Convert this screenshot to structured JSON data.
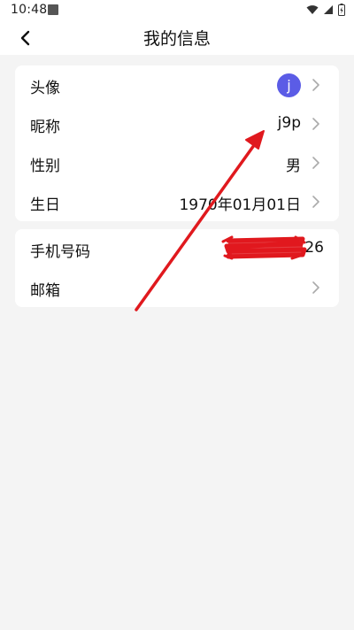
{
  "status_bar": {
    "time": "10:48"
  },
  "header": {
    "title": "我的信息",
    "back_icon": "chevron-left-icon"
  },
  "profile_card": {
    "avatar": {
      "label": "头像",
      "initial": "j",
      "color": "#5b5ce6"
    },
    "nickname": {
      "label": "昵称",
      "value": "j9p"
    },
    "gender": {
      "label": "性别",
      "value": "男"
    },
    "birthday": {
      "label": "生日",
      "value": "1970年01月01日"
    }
  },
  "contact_card": {
    "phone": {
      "label": "手机号码",
      "value_suffix": "26",
      "redacted": true
    },
    "email": {
      "label": "邮箱",
      "value": ""
    }
  },
  "annotation": {
    "arrow_color": "#e0191e",
    "scribble_color": "#e0191e"
  }
}
